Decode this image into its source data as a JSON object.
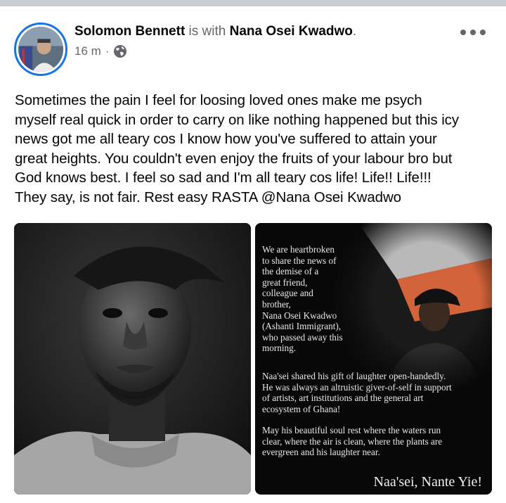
{
  "post": {
    "author": "Solomon Bennett",
    "with_text": " is with ",
    "tagged_user": "Nana Osei Kwadwo",
    "tagged_suffix": ".",
    "timestamp": "16 m",
    "separator": "·",
    "privacy_icon": "globe-icon",
    "more_icon": "more-options-icon",
    "body": "Sometimes the pain I feel for loosing loved ones make me psych\nmyself real quick in order to carry on like nothing happened but this icy\nnews got me all teary cos I know how you've suffered to attain your\ngreat heights. You couldn't even enjoy the fruits of your labour bro but\nGod knows best. I feel so sad and I'm all teary cos life! Life!! Life!!!\nThey say, is not fair. Rest easy RASTA @Nana Osei Kwadwo"
  },
  "memorial_card": {
    "intro": "We are heartbroken\nto share the news of\nthe demise of a\ngreat friend,\ncolleague and\nbrother,\nNana Osei Kwadwo\n(Ashanti Immigrant),\nwho passed away this\nmorning.",
    "paragraph2": "Naa'sei shared his gift of laughter open-handedly.\nHe was always an altruistic giver-of-self in support\nof artists, art institutions and the general art\necosystem of Ghana!",
    "paragraph3": "May his beautiful soul rest where the waters run\nclear, where the air is clean, where the plants are\nevergreen and his laughter near.",
    "signoff": "Naa'sei, Nante Yie!"
  },
  "colors": {
    "ring": "#1b74e4",
    "secondary_text": "#65676b",
    "card_background": "#080808",
    "accent_wall": "#d2633a"
  }
}
